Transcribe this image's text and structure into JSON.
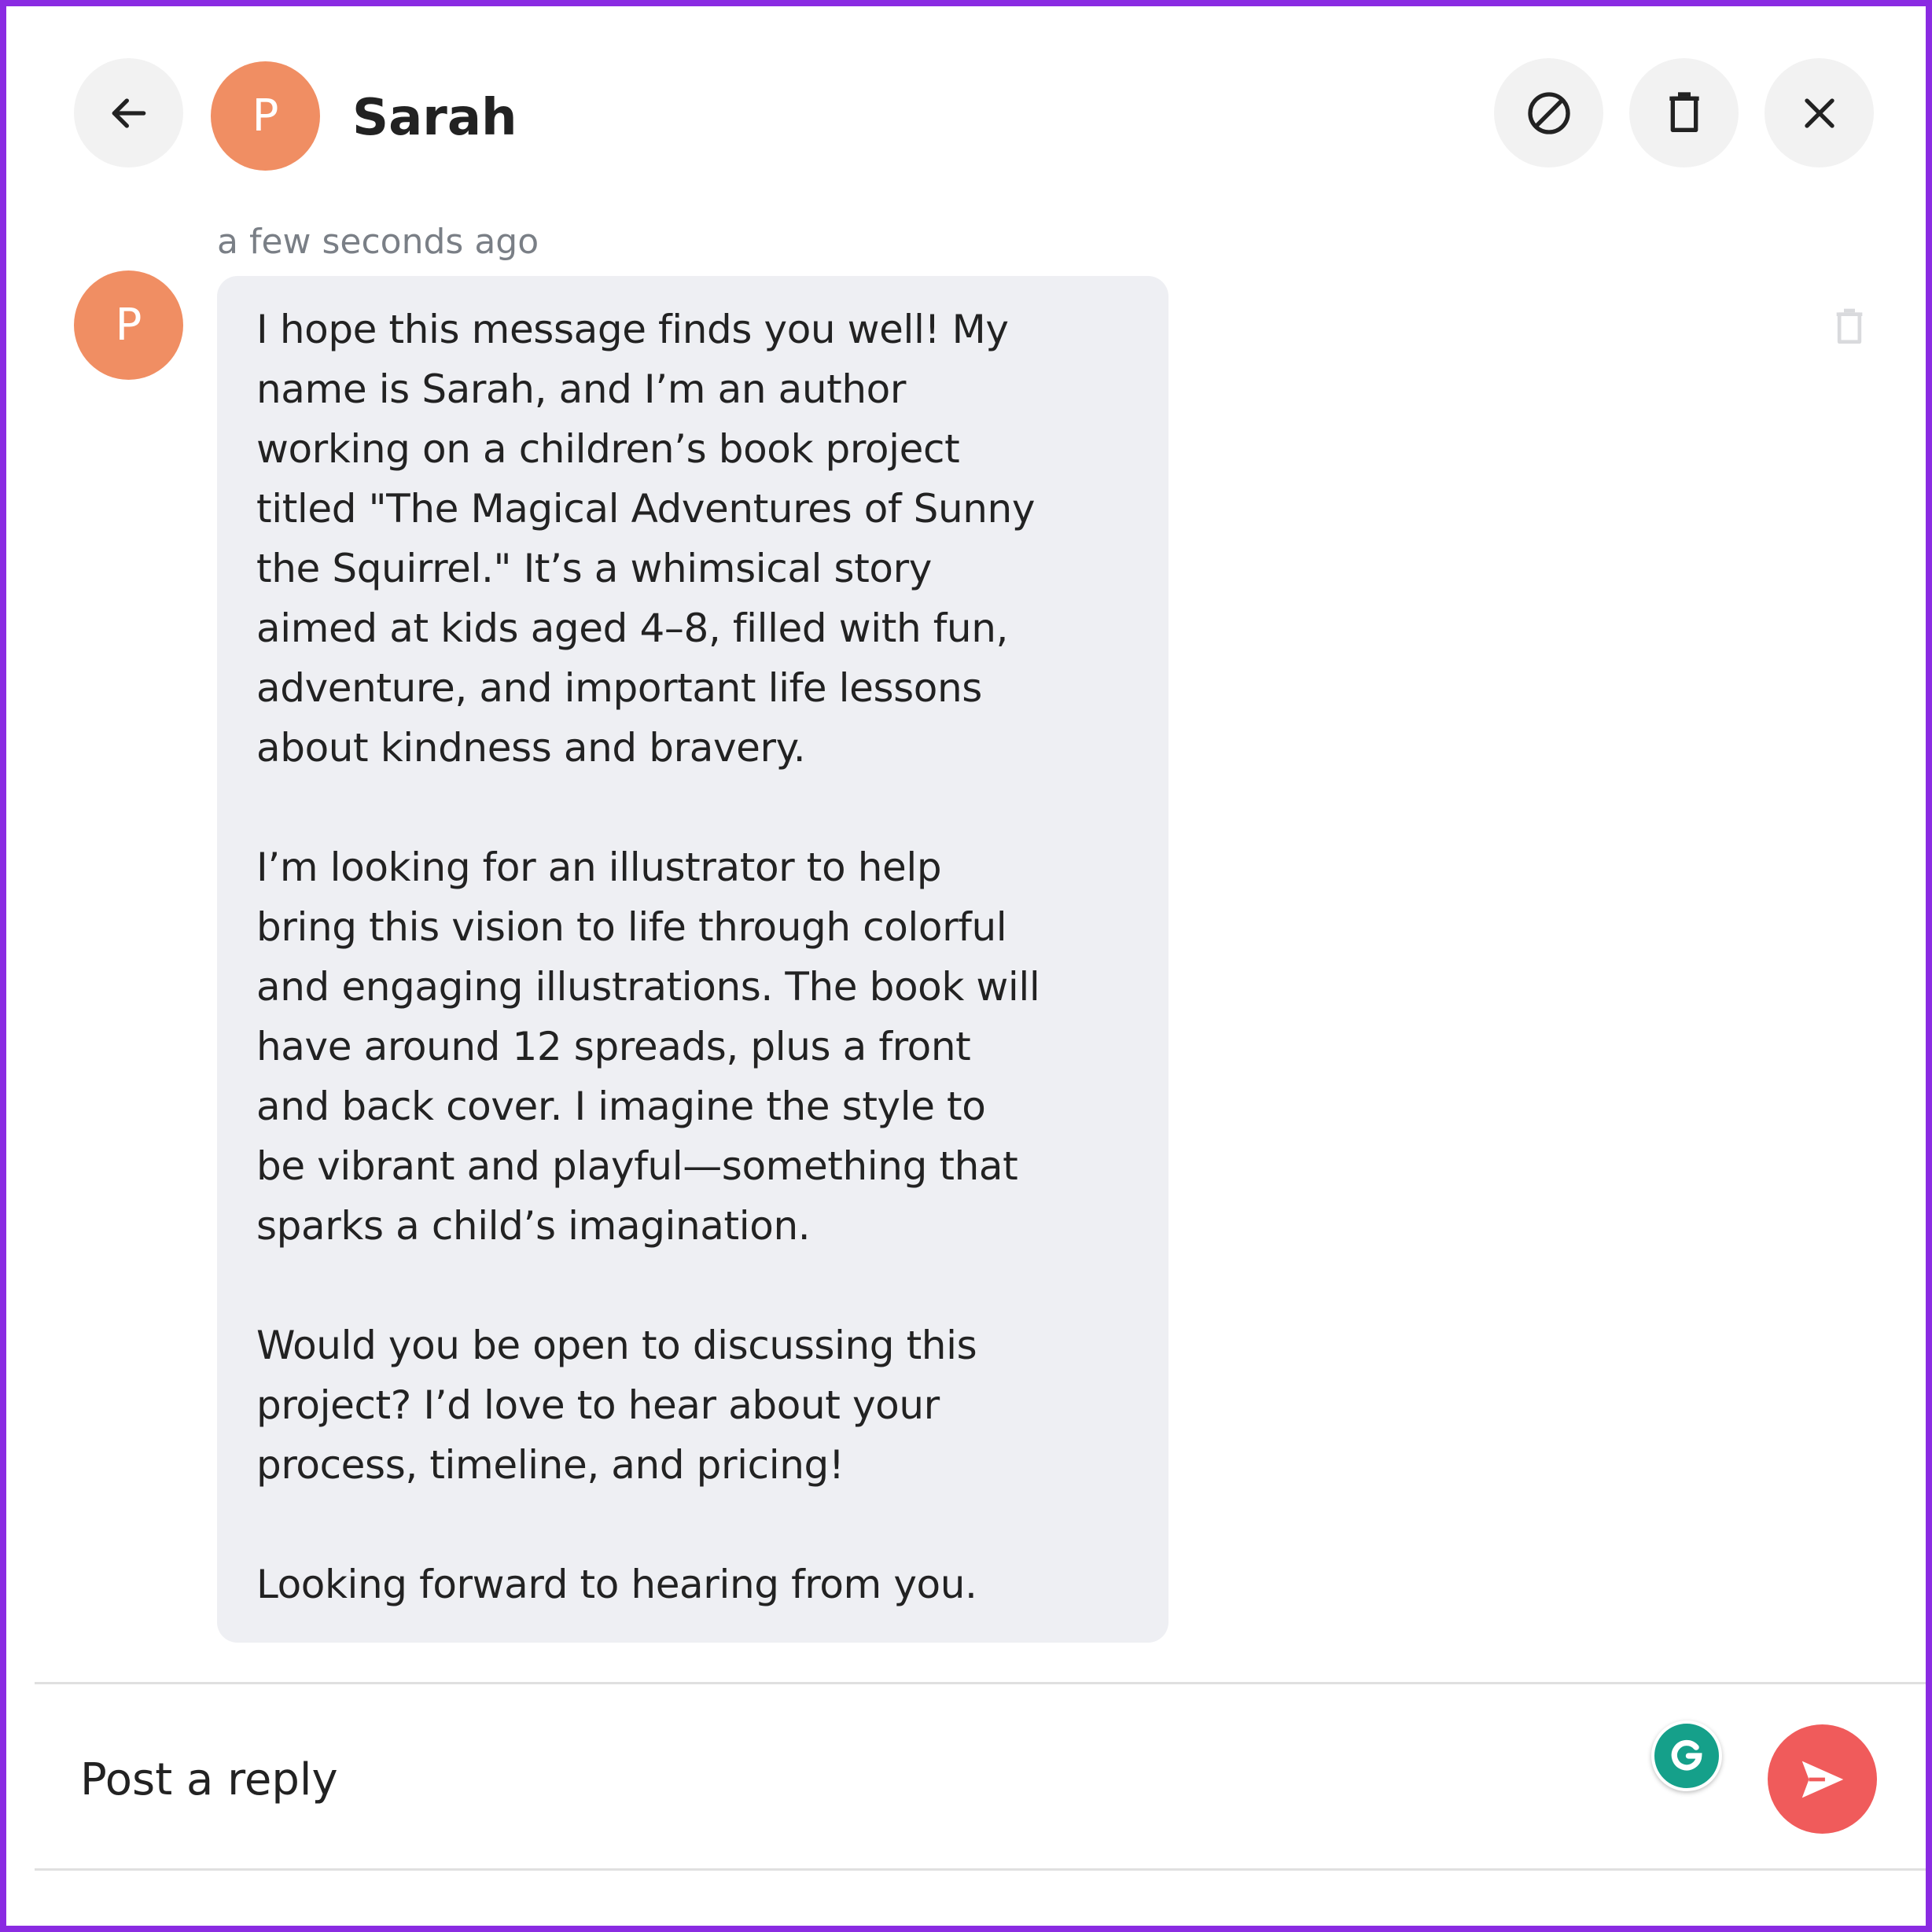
{
  "header": {
    "back_icon": "arrow-left-icon",
    "avatar_initial": "P",
    "contact_name": "Sarah",
    "actions": [
      {
        "icon": "block-icon"
      },
      {
        "icon": "trash-icon"
      },
      {
        "icon": "close-icon"
      }
    ]
  },
  "message": {
    "timestamp": "a few seconds ago",
    "avatar_initial": "P",
    "paragraphs": [
      "I hope this message finds you well! My\nname is Sarah, and I’m an author\nworking on a children’s book project\ntitled \"The Magical Adventures of Sunny\nthe Squirrel.\" It’s a whimsical story\naimed at kids aged 4–8, filled with fun,\nadventure, and important life lessons\nabout kindness and bravery.",
      "I’m looking for an illustrator to help\nbring this vision to life through colorful\nand engaging illustrations. The book will\nhave around 12 spreads, plus a front\nand back cover. I imagine the style to\nbe vibrant and playful—something that\nsparks a child’s imagination.",
      "Would you be open to discussing this\nproject? I’d love to hear about your\nprocess, timeline, and pricing!",
      "Looking forward to hearing from you."
    ],
    "delete_icon": "trash-icon"
  },
  "composer": {
    "placeholder": "Post a reply",
    "grammarly_icon": "grammarly-icon",
    "send_icon": "send-icon"
  },
  "colors": {
    "frame_border": "#8a2be2",
    "avatar": "#f08e63",
    "bubble": "#eeeff3",
    "send_button": "#f05b5b",
    "grammarly": "#15a08a"
  }
}
